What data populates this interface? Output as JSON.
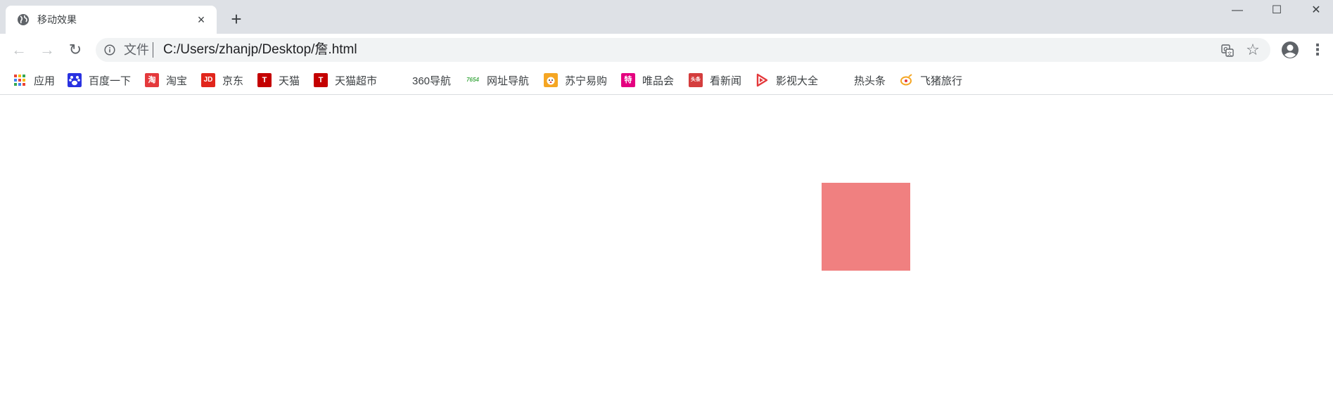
{
  "tab": {
    "title": "移动效果",
    "close_glyph": "×",
    "new_tab_glyph": "+"
  },
  "window_controls": {
    "minimize": "—",
    "maximize": "☐",
    "close": "✕"
  },
  "toolbar": {
    "back_glyph": "←",
    "forward_glyph": "→",
    "reload_glyph": "↻",
    "scheme_label": "文件",
    "url": "C:/Users/zhanjp/Desktop/詹.html",
    "star_glyph": "☆",
    "menu_glyph": "⋮"
  },
  "bookmarks": [
    {
      "label": "应用",
      "icon": "apps-grid-icon"
    },
    {
      "label": "百度一下",
      "icon": "baidu-paw-icon"
    },
    {
      "label": "淘宝",
      "icon": "taobao-icon",
      "icon_text": "淘"
    },
    {
      "label": "京东",
      "icon": "jd-icon",
      "icon_text": "JD"
    },
    {
      "label": "天猫",
      "icon": "tmall-icon",
      "icon_text": "T"
    },
    {
      "label": "天猫超市",
      "icon": "tmall-supermarket-icon",
      "icon_text": "T"
    },
    {
      "label": "360导航",
      "icon": "blank-icon"
    },
    {
      "label": "网址导航",
      "icon": "7654-icon",
      "icon_text": "7654"
    },
    {
      "label": "苏宁易购",
      "icon": "suning-icon"
    },
    {
      "label": "唯品会",
      "icon": "vip-icon",
      "icon_text": "特"
    },
    {
      "label": "看新闻",
      "icon": "toutiao-news-icon",
      "icon_text": "头条"
    },
    {
      "label": "影视大全",
      "icon": "video-play-icon"
    },
    {
      "label": "热头条",
      "icon": "blank-icon"
    },
    {
      "label": "飞猪旅行",
      "icon": "fliggy-icon"
    }
  ],
  "colors": {
    "box": "#f08080",
    "tab_strip": "#dee1e6",
    "omnibox": "#f1f3f4"
  }
}
